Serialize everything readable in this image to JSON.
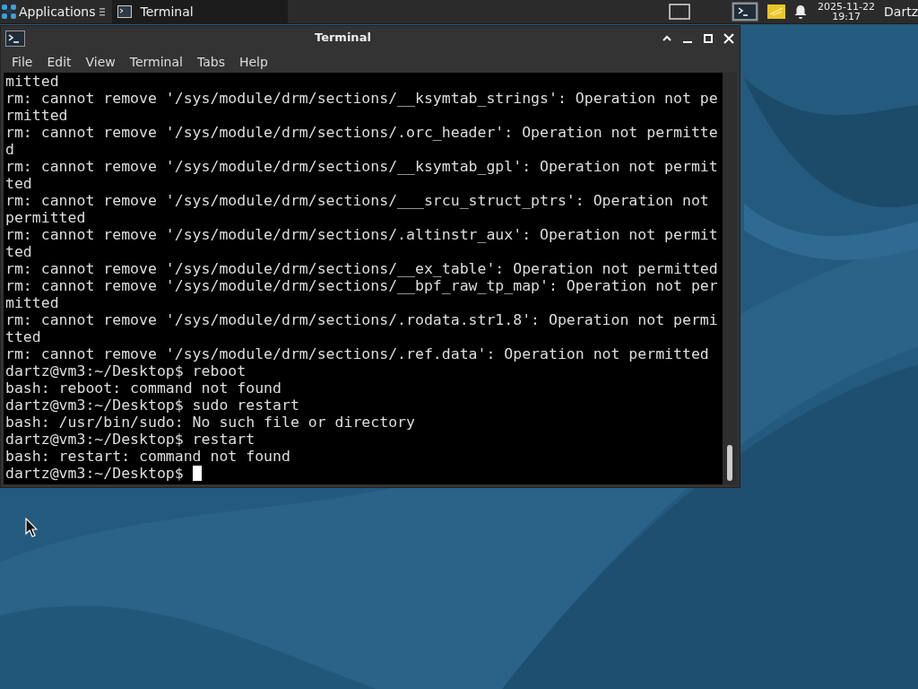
{
  "panel": {
    "apps_menu": "Applications",
    "tasks": [
      {
        "label": "Terminal",
        "selected": true
      }
    ],
    "date": "2025-11-22",
    "time": "19:17",
    "user": "Dartz"
  },
  "window": {
    "title": "Terminal",
    "menu": [
      "File",
      "Edit",
      "View",
      "Terminal",
      "Tabs",
      "Help"
    ],
    "lines": [
      "mitted",
      "rm: cannot remove '/sys/module/drm/sections/__ksymtab_strings': Operation not pe",
      "rmitted",
      "rm: cannot remove '/sys/module/drm/sections/.orc_header': Operation not permitte",
      "d",
      "rm: cannot remove '/sys/module/drm/sections/__ksymtab_gpl': Operation not permit",
      "ted",
      "rm: cannot remove '/sys/module/drm/sections/___srcu_struct_ptrs': Operation not",
      "permitted",
      "rm: cannot remove '/sys/module/drm/sections/.altinstr_aux': Operation not permit",
      "ted",
      "rm: cannot remove '/sys/module/drm/sections/__ex_table': Operation not permitted",
      "rm: cannot remove '/sys/module/drm/sections/__bpf_raw_tp_map': Operation not per",
      "mitted",
      "rm: cannot remove '/sys/module/drm/sections/.rodata.str1.8': Operation not permi",
      "tted",
      "rm: cannot remove '/sys/module/drm/sections/.ref.data': Operation not permitted",
      "dartz@vm3:~/Desktop$ reboot",
      "bash: reboot: command not found",
      "dartz@vm3:~/Desktop$ sudo restart",
      "bash: /usr/bin/sudo: No such file or directory",
      "dartz@vm3:~/Desktop$ restart",
      "bash: restart: command not found",
      "dartz@vm3:~/Desktop$ "
    ]
  }
}
